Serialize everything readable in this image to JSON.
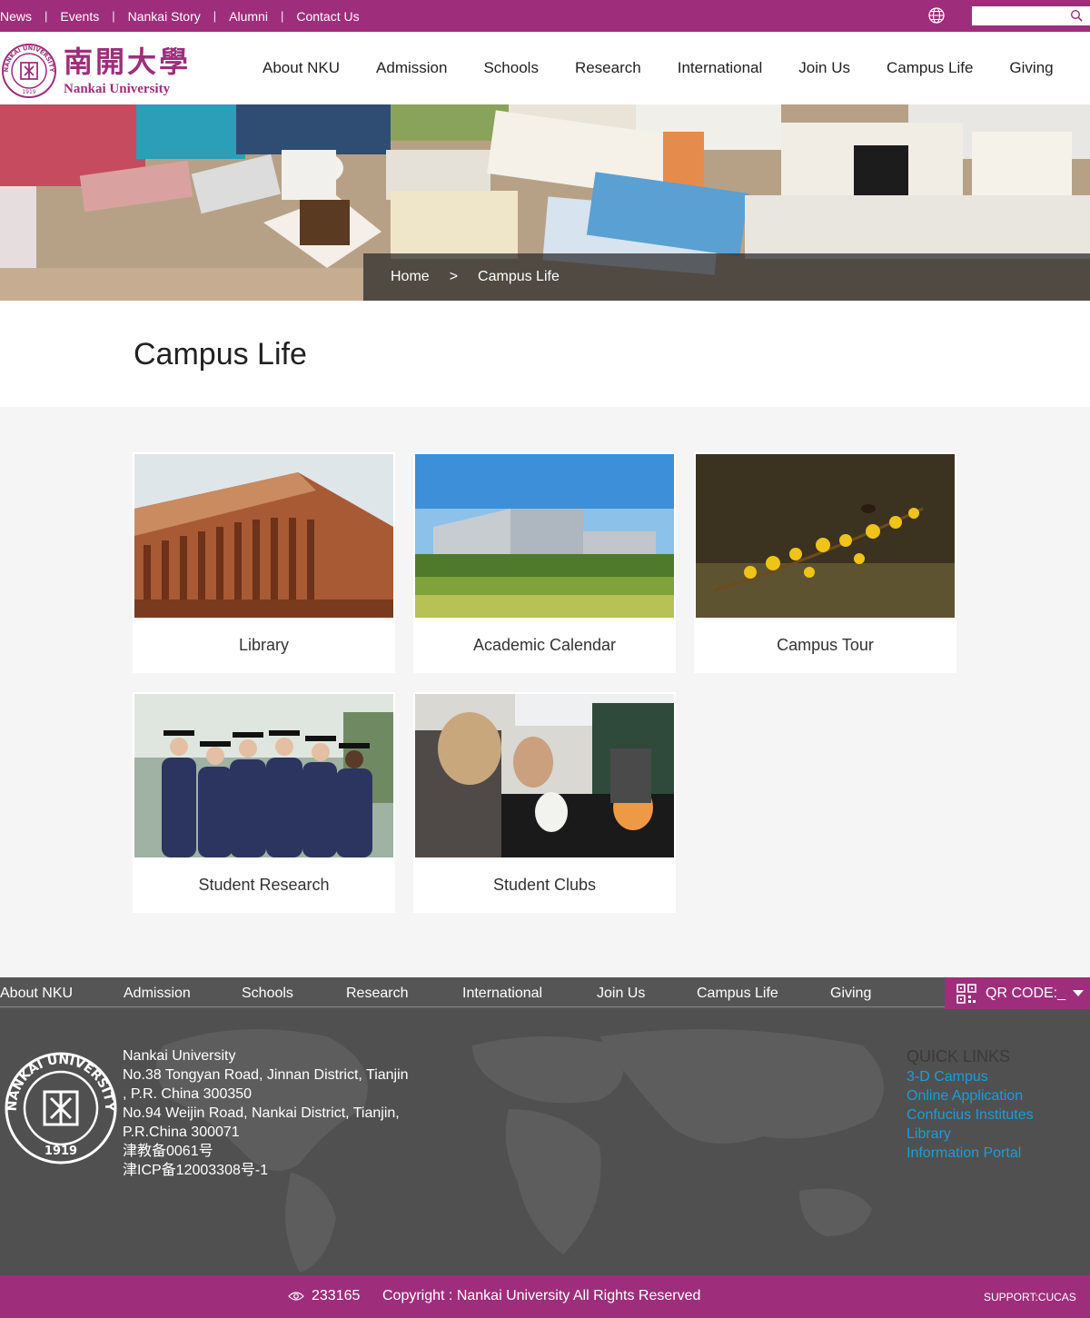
{
  "topbar": {
    "links": [
      "News",
      "Events",
      "Nankai Story",
      "Alumni",
      "Contact Us"
    ],
    "search_placeholder": ""
  },
  "header": {
    "logo_cn": "南開大學",
    "logo_en": "Nankai University",
    "seal_text": "NANKAI UNIVERSITY",
    "seal_year": "1919",
    "nav": [
      "About NKU",
      "Admission",
      "Schools",
      "Research",
      "International",
      "Join Us",
      "Campus Life",
      "Giving"
    ]
  },
  "breadcrumb": {
    "home": "Home",
    "arrow": ">",
    "current": "Campus Life"
  },
  "page_title": "Campus Life",
  "cards": [
    {
      "label": "Library",
      "image": "library-building-photo"
    },
    {
      "label": "Academic Calendar",
      "image": "modern-building-photo"
    },
    {
      "label": "Campus Tour",
      "image": "yellow-flowers-bee-photo"
    },
    {
      "label": "Student Research",
      "image": "graduates-photo"
    },
    {
      "label": "Student Clubs",
      "image": "students-painting-photo"
    }
  ],
  "footer_nav": [
    "About NKU",
    "Admission",
    "Schools",
    "Research",
    "International",
    "Join Us",
    "Campus Life",
    "Giving"
  ],
  "qr_label": "QR CODE:_",
  "footer": {
    "address_lines": [
      "Nankai University",
      "No.38 Tongyan Road, Jinnan District, Tianjin",
      ", P.R. China 300350",
      "No.94 Weijin Road,  Nankai District, Tianjin,",
      "P.R.China  300071",
      "津教备0061号",
      "津ICP备12003308号-1"
    ],
    "quick_links_title": "QUICK LINKS",
    "quick_links": [
      "3-D Campus",
      "Online Application",
      "Confucius Institutes",
      "Library",
      "Information Portal"
    ]
  },
  "bottom": {
    "visits": "233165",
    "copyright": "Copyright : Nankai University All Rights Reserved",
    "support": "SUPPORT:CUCAS"
  },
  "colors": {
    "brand": "#9e2e7b",
    "link": "#1e9cd7",
    "footer_bg": "#505050"
  }
}
